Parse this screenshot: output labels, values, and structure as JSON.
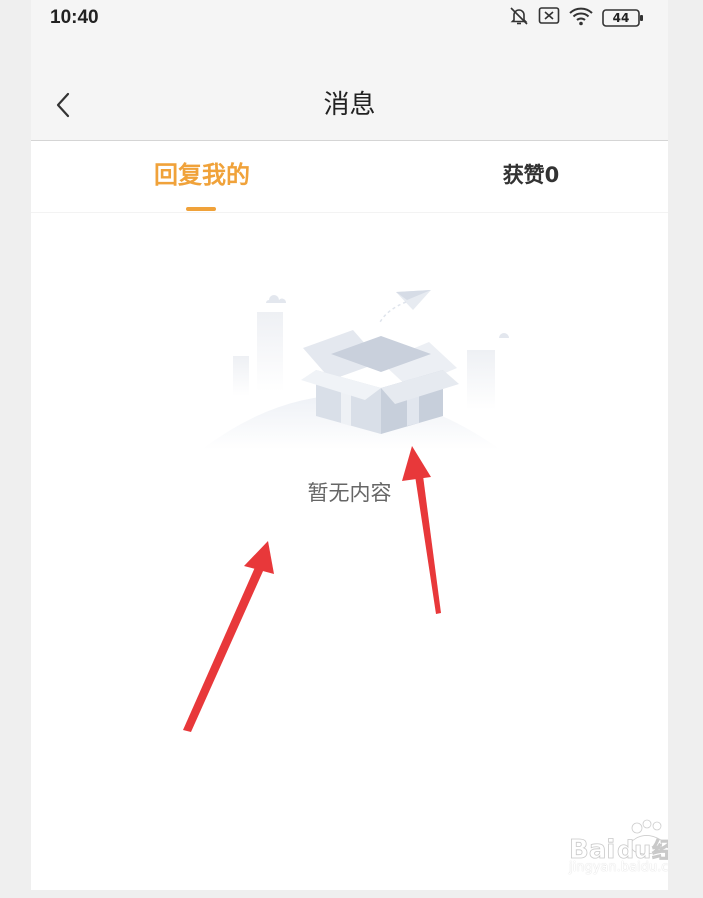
{
  "status_bar": {
    "time": "10:40",
    "battery": "44",
    "icons": [
      "bell-muted-icon",
      "sim-disabled-icon",
      "wifi-icon",
      "battery-icon"
    ]
  },
  "header": {
    "title": "消息",
    "back_icon": "back-chevron-icon"
  },
  "tabs": [
    {
      "label": "回复我的",
      "active": true
    },
    {
      "label": "获赞0",
      "active": false
    }
  ],
  "empty_state": {
    "message": "暂无内容",
    "icon": "empty-box-icon"
  },
  "watermark": {
    "logo_text": "Baidu经验",
    "url": "jingyan.baidu.com"
  },
  "colors": {
    "accent": "#f0a23a",
    "annotation_arrow": "#e8383a",
    "header_bg": "#f5f5f5"
  }
}
